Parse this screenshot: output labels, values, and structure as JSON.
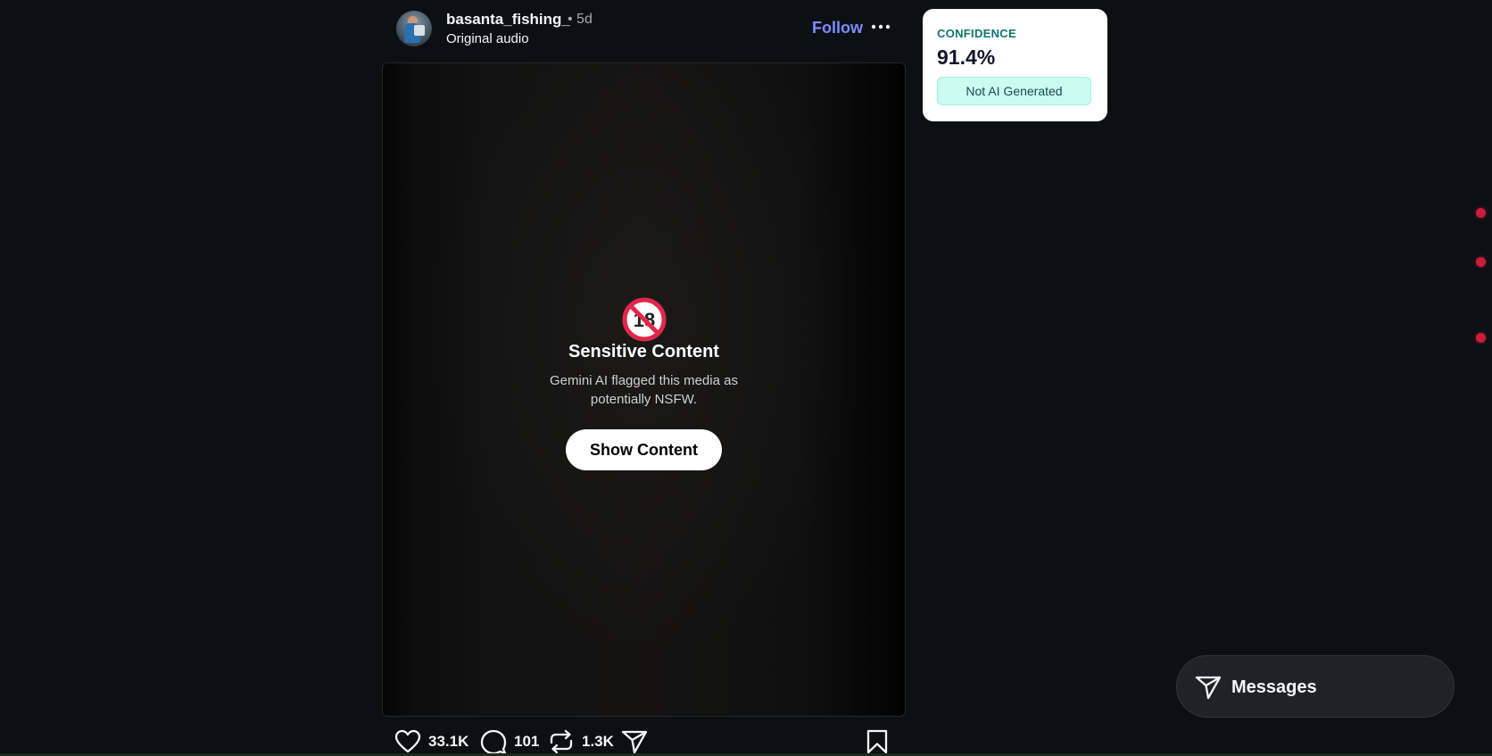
{
  "post": {
    "username": "basanta_fishing_",
    "time": "• 5d",
    "audio": "Original audio",
    "follow_label": "Follow",
    "more_icon": "more-horizontal-icon"
  },
  "media": {
    "warning_icon": "no-under-18-icon",
    "warning_glyph": "18",
    "title": "Sensitive Content",
    "description": "Gemini AI flagged this media as potentially NSFW.",
    "show_button": "Show Content"
  },
  "actions": {
    "likes": "33.1K",
    "comments": "101",
    "reposts": "1.3K"
  },
  "confidence": {
    "label": "CONFIDENCE",
    "value": "91.4%",
    "verdict": "Not AI Generated",
    "accent": "#0f766e",
    "badge_bg": "#ccfbf1"
  },
  "messages": {
    "label": "Messages"
  },
  "colors": {
    "background": "#0c1014",
    "follow": "#7f8cff",
    "notification_dot": "#c81e3a"
  }
}
